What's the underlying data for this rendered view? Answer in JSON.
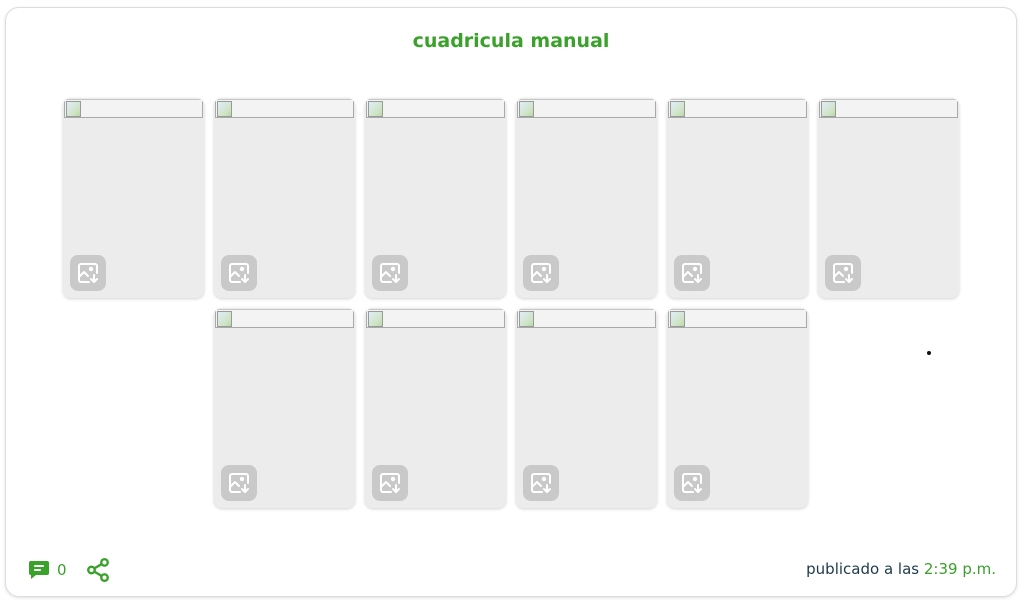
{
  "post": {
    "title": "cuadricula manual",
    "comment_count": "0",
    "published_prefix": "publicado a las",
    "published_time": "2:39 p.m."
  },
  "grid": {
    "row1_count": 6,
    "row2_count": 4,
    "image_state": "broken-image placeholder",
    "tile_color": "#ececec"
  },
  "colors": {
    "accent": "#3aa12a",
    "text_dark": "#1e3a4a",
    "download_button": "#c9c9c9"
  },
  "icons": {
    "tile_action": "download-image-icon",
    "comments": "comment-icon",
    "share": "share-icon"
  }
}
